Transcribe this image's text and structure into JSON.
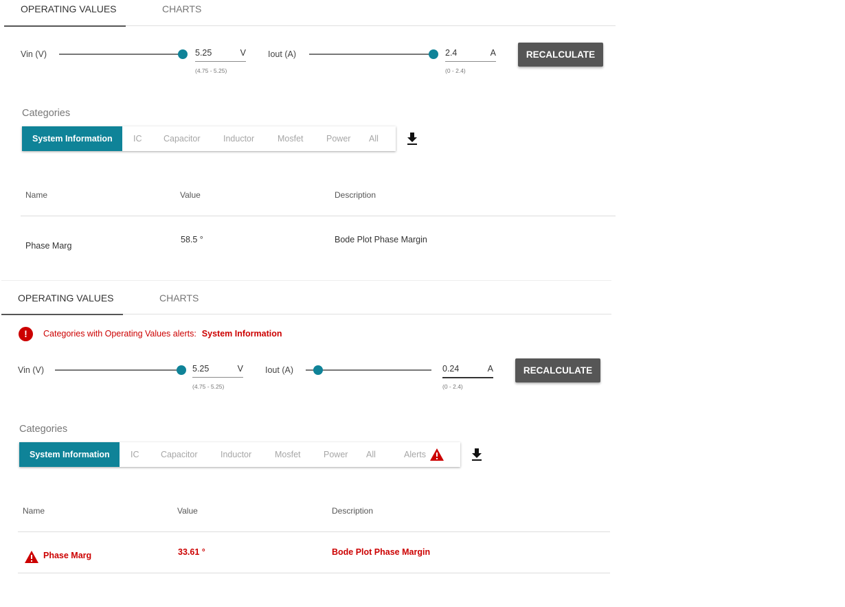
{
  "tabs": [
    "OPERATING VALUES",
    "CHARTS"
  ],
  "controls": {
    "vin_label": "Vin (V)",
    "iout_label": "Iout (A)",
    "recalculate_label": "RECALCULATE"
  },
  "panel1": {
    "vin": {
      "value": "5.25",
      "unit": "V",
      "range": "(4.75 - 5.25)",
      "slider_fraction": 1.0
    },
    "iout": {
      "value": "2.4",
      "unit": "A",
      "range": "(0 - 2.4)",
      "slider_fraction": 1.0
    },
    "categories_title": "Categories",
    "categories": [
      "System Information",
      "IC",
      "Capacitor",
      "Inductor",
      "Mosfet",
      "Power",
      "All"
    ],
    "active_category": "System Information",
    "table": {
      "headers": [
        "Name",
        "Value",
        "Description"
      ],
      "rows": [
        {
          "name": "Phase Marg",
          "value": "58.5 °",
          "description": "Bode Plot Phase Margin",
          "alert": false
        }
      ]
    }
  },
  "panel2": {
    "alert_text": "Categories with Operating Values alerts:",
    "alert_categories": "System Information",
    "vin": {
      "value": "5.25",
      "unit": "V",
      "range": "(4.75 - 5.25)",
      "slider_fraction": 1.0
    },
    "iout": {
      "value": "0.24",
      "unit": "A",
      "range": "(0 - 2.4)",
      "slider_fraction": 0.1
    },
    "categories_title": "Categories",
    "categories": [
      "System Information",
      "IC",
      "Capacitor",
      "Inductor",
      "Mosfet",
      "Power",
      "All",
      "Alerts"
    ],
    "active_category": "System Information",
    "table": {
      "headers": [
        "Name",
        "Value",
        "Description"
      ],
      "rows": [
        {
          "name": "Phase Marg",
          "value": "33.61 °",
          "description": "Bode Plot Phase Margin",
          "alert": true
        }
      ]
    }
  },
  "colors": {
    "accent": "#0f8398",
    "alert": "#cc0000",
    "button": "#565656"
  },
  "icons": [
    "download-icon",
    "error-circle-icon",
    "warning-triangle-icon"
  ]
}
